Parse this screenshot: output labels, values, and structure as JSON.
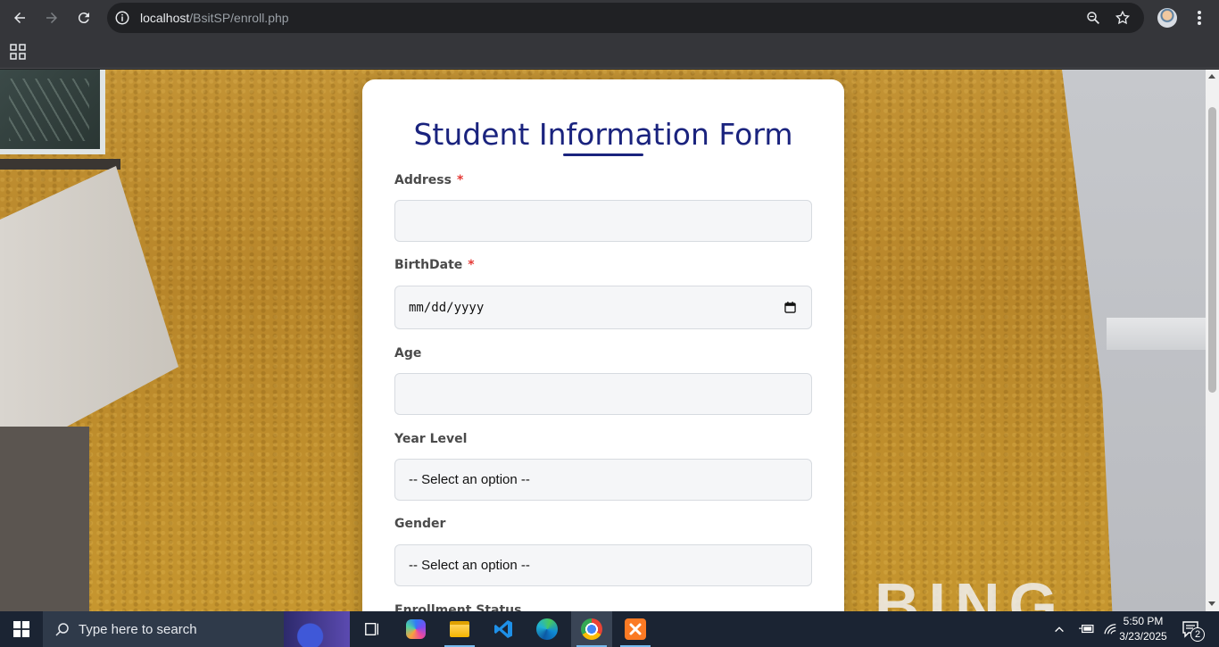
{
  "browser": {
    "url_host": "localhost",
    "url_path": "/BsitSP/enroll.php"
  },
  "form": {
    "title": "Student Information Form",
    "required_marker": "*",
    "fields": [
      {
        "label": "Address",
        "required": true,
        "type": "text",
        "value": ""
      },
      {
        "label": "BirthDate",
        "required": true,
        "type": "date",
        "value": "mm/dd/yyyy"
      },
      {
        "label": "Age",
        "required": false,
        "type": "text",
        "value": ""
      },
      {
        "label": "Year Level",
        "required": false,
        "type": "select",
        "value": "-- Select an option --"
      },
      {
        "label": "Gender",
        "required": false,
        "type": "select",
        "value": "-- Select an option --"
      },
      {
        "label": "Enrollment Status",
        "required": false,
        "type": "select",
        "value": ""
      }
    ]
  },
  "background": {
    "letters": "BING"
  },
  "taskbar": {
    "search_placeholder": "Type here to search",
    "time": "5:50 PM",
    "date": "3/23/2025",
    "notification_count": "2"
  },
  "colors": {
    "title": "#1a237e",
    "required": "#e53935",
    "taskbar": "#1b2433"
  }
}
